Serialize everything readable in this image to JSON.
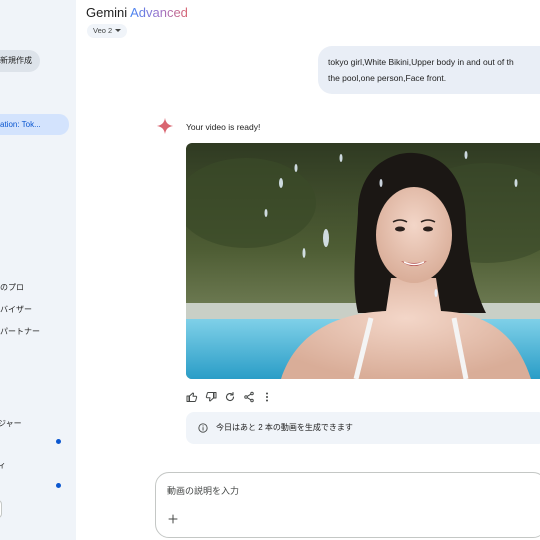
{
  "sidebar": {
    "new_chat": "新規作成",
    "active_item": "ation: Tok...",
    "items": [
      {
        "label": "のプロ"
      },
      {
        "label": "バイザー"
      },
      {
        "label": "パートナー"
      },
      {
        "label": "ジャー"
      },
      {
        "label": "ィ"
      }
    ]
  },
  "header": {
    "app_name": "Gemini",
    "app_tier": "Advanced",
    "model": "Veo 2"
  },
  "conversation": {
    "user_prompt_line1": "tokyo girl,White Bikini,Upper body in and out of th",
    "user_prompt_line2": "the pool,one person,Face front.",
    "response_text": "Your video is ready!",
    "limit_notice": "今日はあと 2 本の動画を生成できます"
  },
  "input": {
    "placeholder": "動画の説明を入力"
  },
  "colors": {
    "sidebar_bg": "#f0f4f9",
    "accent_blue": "#0b57d0",
    "spark": "#d96570",
    "bubble_bg": "#e9eef6"
  },
  "icons": {
    "spark": "gemini-spark-icon",
    "thumbs_up": "thumbs-up-icon",
    "thumbs_down": "thumbs-down-icon",
    "regenerate": "regenerate-icon",
    "share": "share-icon",
    "more": "more-vert-icon",
    "info": "info-icon",
    "add": "plus-icon"
  }
}
